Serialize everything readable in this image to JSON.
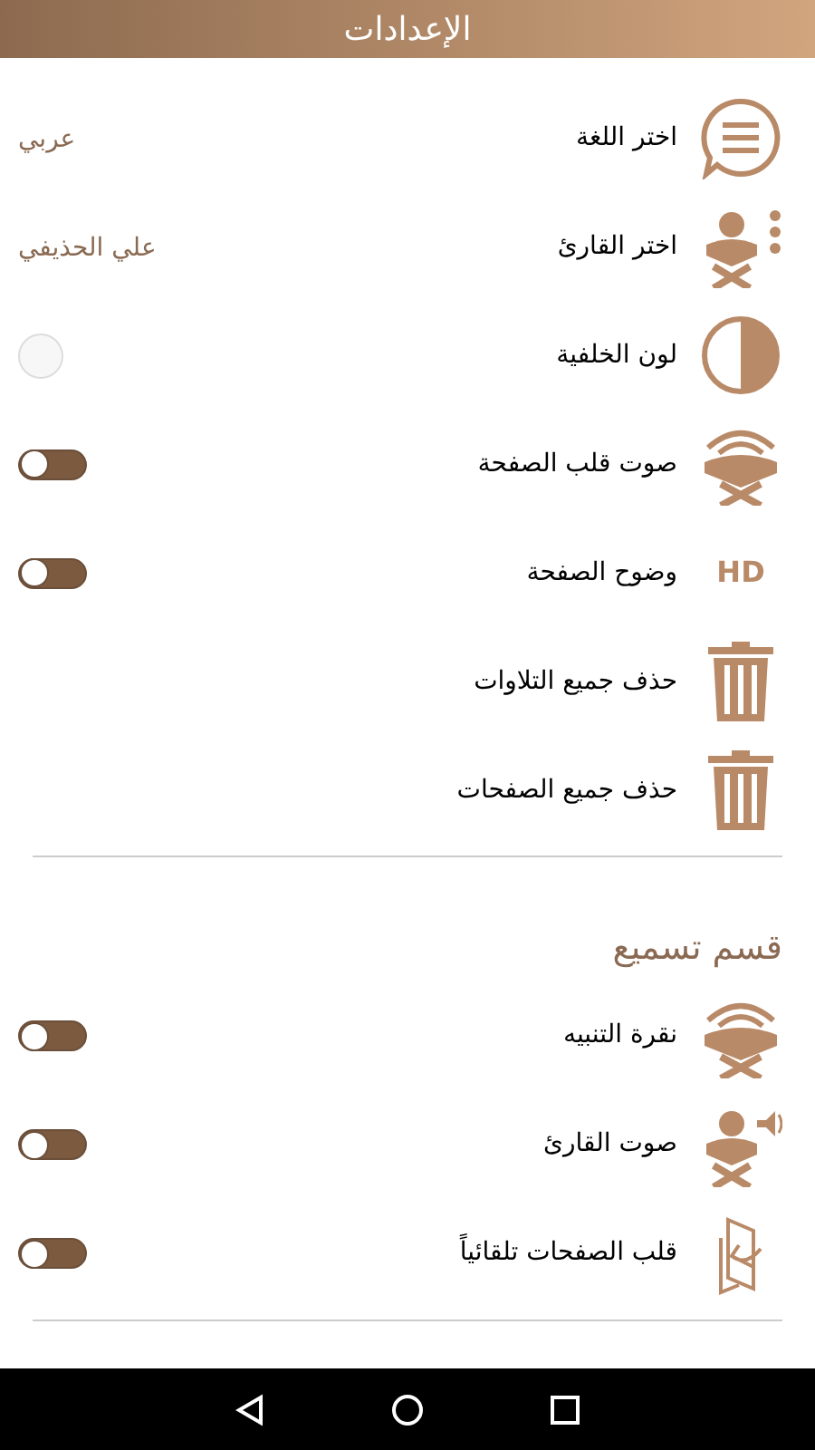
{
  "header": {
    "title": "الإعدادات"
  },
  "sections": [
    {
      "items": [
        {
          "kind": "value",
          "label": "اختر اللغة",
          "value": "عربي"
        },
        {
          "kind": "value",
          "label": "اختر القارئ",
          "value": "علي الحذيفي"
        },
        {
          "kind": "color",
          "label": "لون الخلفية",
          "color": "#f7f7f7"
        },
        {
          "kind": "toggle",
          "label": "صوت قلب الصفحة",
          "on": false
        },
        {
          "kind": "toggle",
          "label": "وضوح الصفحة",
          "on": false,
          "badge": "HD"
        },
        {
          "kind": "action",
          "label": "حذف جميع التلاوات"
        },
        {
          "kind": "action",
          "label": "حذف جميع الصفحات"
        }
      ]
    },
    {
      "title": "قسم تسميع",
      "items": [
        {
          "kind": "toggle",
          "label": "نقرة التنبيه",
          "on": false
        },
        {
          "kind": "toggle",
          "label": "صوت القارئ",
          "on": false
        },
        {
          "kind": "toggle",
          "label": "قلب الصفحات تلقائياً",
          "on": false
        }
      ]
    }
  ]
}
